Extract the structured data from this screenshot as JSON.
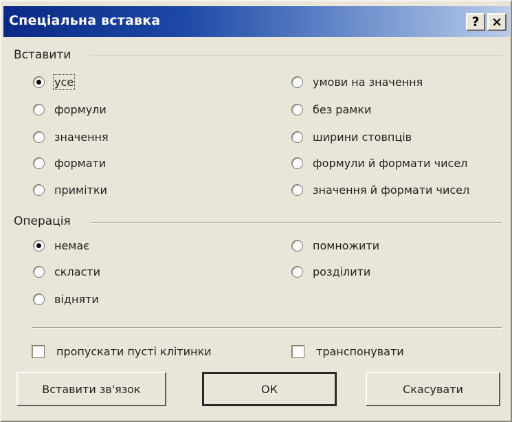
{
  "dialog": {
    "title": "Спеціальна вставка",
    "help_label": "?",
    "close_label": "×"
  },
  "paste_group": {
    "label": "Вставити",
    "options_left": [
      {
        "label": "усе",
        "checked": true
      },
      {
        "label": "формули",
        "checked": false
      },
      {
        "label": "значення",
        "checked": false
      },
      {
        "label": "формати",
        "checked": false
      },
      {
        "label": "примітки",
        "checked": false
      }
    ],
    "options_right": [
      {
        "label": "умови на значення",
        "checked": false
      },
      {
        "label": "без рамки",
        "checked": false
      },
      {
        "label": "ширини стовпців",
        "checked": false
      },
      {
        "label": "формули й формати чисел",
        "checked": false
      },
      {
        "label": "значення й формати чисел",
        "checked": false
      }
    ]
  },
  "operation_group": {
    "label": "Операція",
    "options_left": [
      {
        "label": "немає",
        "checked": true
      },
      {
        "label": "скласти",
        "checked": false
      },
      {
        "label": "відняти",
        "checked": false
      }
    ],
    "options_right": [
      {
        "label": "помножити",
        "checked": false
      },
      {
        "label": "розділити",
        "checked": false
      }
    ]
  },
  "checkboxes": {
    "skip_blanks": {
      "label": "пропускати пусті клітинки",
      "checked": false
    },
    "transpose": {
      "label": "транспонувати",
      "checked": false
    }
  },
  "buttons": {
    "paste_link": "Вставити зв'язок",
    "ok": "ОК",
    "cancel": "Скасувати"
  }
}
